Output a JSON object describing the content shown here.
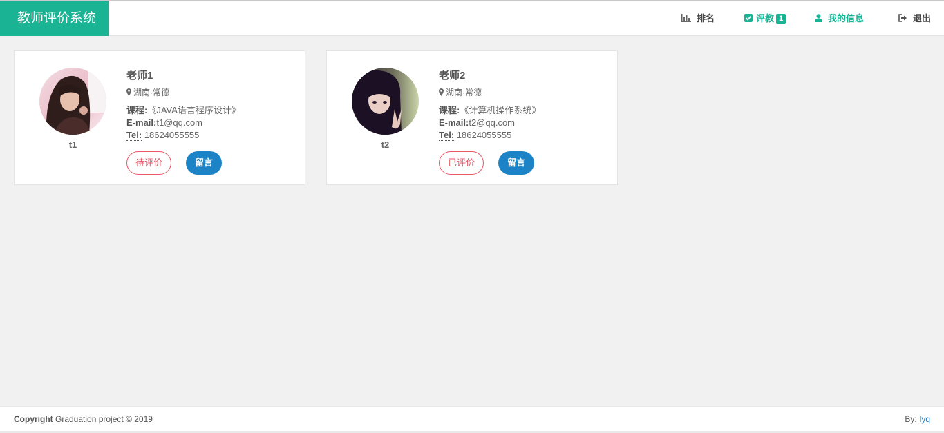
{
  "app": {
    "title": "教师评价系统",
    "brand_color": "#1ab394"
  },
  "nav": {
    "ranking": {
      "label": "排名",
      "icon": "bar-chart-icon"
    },
    "evaluate": {
      "label": "评教",
      "badge": "1",
      "icon": "check-square-icon"
    },
    "my_info": {
      "label": "我的信息",
      "icon": "user-icon"
    },
    "logout": {
      "label": "退出",
      "icon": "sign-out-icon"
    }
  },
  "teachers": [
    {
      "avatar_caption": "t1",
      "name": "老师1",
      "location": "湖南·常德",
      "course_label": "课程:",
      "course": "《JAVA语言程序设计》",
      "email_label": "E-mail:",
      "email": "t1@qq.com",
      "tel_label": "Tel:",
      "tel": " 18624055555",
      "status_label": "待评价",
      "message_label": "留言"
    },
    {
      "avatar_caption": "t2",
      "name": "老师2",
      "location": "湖南·常德",
      "course_label": "课程:",
      "course": "《计算机操作系统》",
      "email_label": "E-mail:",
      "email": "t2@qq.com",
      "tel_label": "Tel:",
      "tel": " 18624055555",
      "status_label": "已评价",
      "message_label": "留言"
    }
  ],
  "footer": {
    "copyright_bold": "Copyright",
    "copyright_text": " Graduation project © 2019",
    "by_label": "By:",
    "author": "lyq"
  }
}
